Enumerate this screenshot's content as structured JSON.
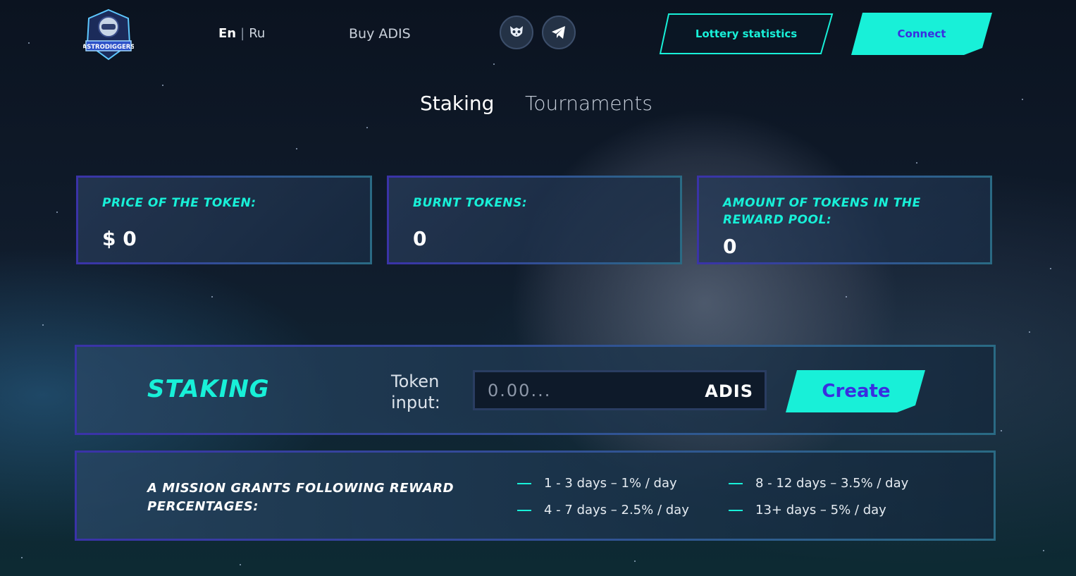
{
  "header": {
    "logo_text": "ASTRODIGGERS",
    "lang_en": "En",
    "lang_separator": "|",
    "lang_ru": "Ru",
    "buy_label": "Buy ADIS",
    "social_icons": [
      "owl-icon",
      "telegram-icon"
    ],
    "lottery_label": "Lottery statistics",
    "connect_label": "Connect"
  },
  "tabs": [
    {
      "label": "Staking",
      "active": true
    },
    {
      "label": "Tournaments",
      "active": false
    }
  ],
  "stats": [
    {
      "label": "PRICE OF THE TOKEN:",
      "value": "$ 0"
    },
    {
      "label": "BURNT TOKENS:",
      "value": "0"
    },
    {
      "label": "AMOUNT OF TOKENS IN THE REWARD POOL:",
      "value": "0"
    }
  ],
  "staking": {
    "title": "STAKING",
    "token_label": "Token input:",
    "input_placeholder": "0.00...",
    "input_unit": "ADIS",
    "create_label": "Create"
  },
  "rewards": {
    "title": "A MISSION GRANTS FOLLOWING REWARD PERCENTAGES:",
    "items": [
      "1 - 3 days – 1% / day",
      "4 - 7 days – 2.5% / day",
      "8 - 12 days – 3.5% / day",
      "13+ days – 5% / day"
    ]
  },
  "colors": {
    "accent": "#18f0d8",
    "button_text": "#3a2ee0",
    "border": "#3a33a8"
  }
}
